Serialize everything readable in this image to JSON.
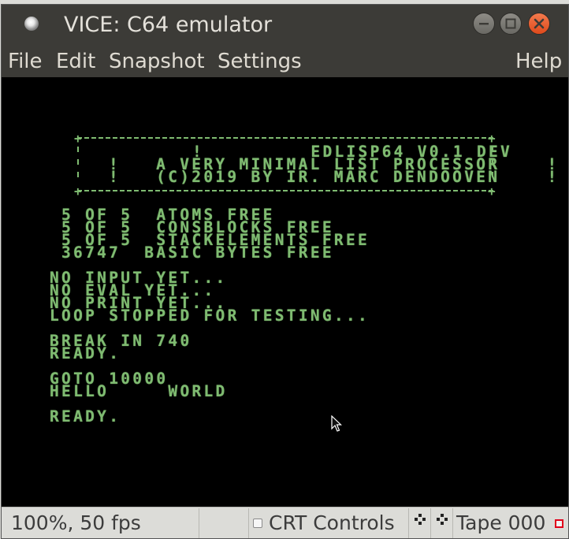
{
  "window": {
    "title": "VICE: C64 emulator"
  },
  "menu": {
    "file": "File",
    "edit": "Edit",
    "snapshot": "Snapshot",
    "settings": "Settings",
    "help": "Help"
  },
  "screen": {
    "banner": {
      "border_top": "+------------------------------+",
      "line1": "!         EDLISP64 V0.1 DEV          !",
      "line2": "!   A VERY MINIMAL LIST PROCESSOR    !",
      "line3": "!   (C)2019 BY IR. MARC DENDOOVEN    !",
      "border_bottom": "+------------------------------+"
    },
    "memory_lines": [
      "5 OF 5  ATOMS FREE",
      "5 OF 5  CONSBLOCKS FREE",
      "5 OF 5  STACKELEMENTS FREE",
      "36747  BASIC BYTES FREE"
    ],
    "loop_lines": [
      "NO INPUT YET...",
      "NO EVAL YET...",
      "NO PRINT YET...",
      "LOOP STOPPED FOR TESTING..."
    ],
    "break_lines": [
      "BREAK IN 740",
      "READY."
    ],
    "goto_lines": [
      "GOTO 10000",
      "HELLO     WORLD"
    ],
    "final_ready": "READY."
  },
  "status": {
    "speed": "100%, 50 fps",
    "crt_label": "CRT Controls",
    "crt_checked": false,
    "tape": "Tape 000",
    "tape_led_color": "#e0001a"
  },
  "colors": {
    "c64_text": "#7fbb71",
    "c64_background": "#000000",
    "titlebar": "#3c3b37"
  }
}
